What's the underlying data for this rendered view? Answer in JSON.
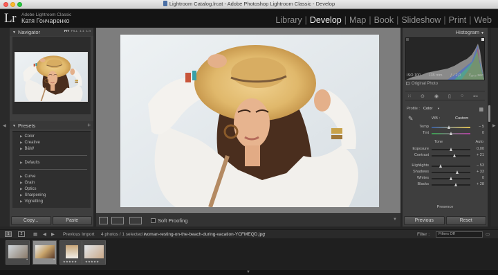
{
  "window": {
    "title": "Lightroom Catalog.lrcat - Adobe Photoshop Lightroom Classic - Develop"
  },
  "identity": {
    "logo": "Lr",
    "product": "Adobe Lightroom Classic",
    "user": "Катя Гончаренко"
  },
  "modules": [
    {
      "label": "Library",
      "active": false
    },
    {
      "label": "Develop",
      "active": true
    },
    {
      "label": "Map",
      "active": false
    },
    {
      "label": "Book",
      "active": false
    },
    {
      "label": "Slideshow",
      "active": false
    },
    {
      "label": "Print",
      "active": false
    },
    {
      "label": "Web",
      "active": false
    }
  ],
  "navigator": {
    "title": "Navigator",
    "zoom": [
      "FIT",
      "FILL",
      "1:1",
      "1:4"
    ]
  },
  "presets": {
    "title": "Presets",
    "add": "+",
    "groups": [
      [
        "Color",
        "Creative",
        "B&W"
      ],
      [
        "Defaults"
      ],
      [
        "Curve",
        "Grain",
        "Optics",
        "Sharpening",
        "Vignetting"
      ]
    ]
  },
  "left_buttons": {
    "copy": "Copy...",
    "paste": "Paste"
  },
  "toolbar": {
    "soft_proofing": "Soft Proofing"
  },
  "histogram": {
    "title": "Histogram",
    "iso": "ISO 100",
    "focal": "135 mm",
    "aperture": "ƒ / 2,0",
    "shutter": "¹⁄₁₆₀₀ sec",
    "original": "Original Photo"
  },
  "basic": {
    "profile_label": "Profile :",
    "profile_value": "Color",
    "wb_label": "WB :",
    "wb_value": "Custom",
    "tone_label": "Tone",
    "auto_label": "Auto",
    "presence_label": "Presence",
    "sliders": [
      {
        "label": "Temp",
        "value": "− 5",
        "pos": 0.45,
        "kind": "temp"
      },
      {
        "label": "Tint",
        "value": "0",
        "pos": 0.5,
        "kind": "tint"
      },
      {
        "label": "Exposure",
        "value": "0,00",
        "pos": 0.5,
        "kind": "plain"
      },
      {
        "label": "Contrast",
        "value": "+ 21",
        "pos": 0.6,
        "kind": "plain"
      },
      {
        "label": "Highlights",
        "value": "− 53",
        "pos": 0.24,
        "kind": "plain"
      },
      {
        "label": "Shadows",
        "value": "+ 33",
        "pos": 0.67,
        "kind": "plain"
      },
      {
        "label": "Whites",
        "value": "0",
        "pos": 0.5,
        "kind": "plain"
      },
      {
        "label": "Blacks",
        "value": "+ 28",
        "pos": 0.64,
        "kind": "plain"
      }
    ]
  },
  "right_buttons": {
    "previous": "Previous",
    "reset": "Reset"
  },
  "filmstrip": {
    "page1": "1",
    "page2": "2",
    "source": "Previous Import",
    "count": "4 photos / 1 selected /",
    "filename": "woman-resting-on-the-beach-during-vacation-YCFMEQD.jpg",
    "filter_label": "Filter :",
    "filter_value": "Filters Off",
    "stars": "★★★★★"
  }
}
